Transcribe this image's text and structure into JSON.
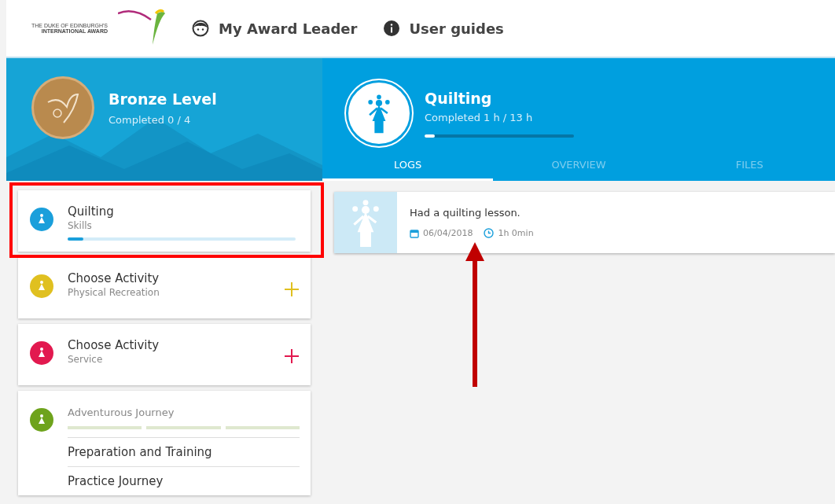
{
  "header": {
    "logo": {
      "line_1": "THE DUKE OF EDINBURGH'S",
      "line_2": "INTERNATIONAL AWARD"
    },
    "nav": [
      {
        "label": "My Award Leader",
        "kind": "face"
      },
      {
        "label": "User guides",
        "kind": "info"
      }
    ]
  },
  "level": {
    "title": "Bronze Level",
    "progress": "Completed 0 / 4"
  },
  "activity": {
    "title": "Quilting",
    "progress": "Completed 1 h / 13 h",
    "level": 0.07
  },
  "tabs": [
    {
      "label": "LOGS",
      "selected": true
    },
    {
      "label": "OVERVIEW",
      "selected": false
    },
    {
      "label": "FILES",
      "selected": false
    }
  ],
  "sections": [
    {
      "kind": "activity",
      "title": "Quilting",
      "subtitle": "Skills",
      "color": "#1a9fdb",
      "level": 0.07
    },
    {
      "kind": "choose",
      "title": "Choose Activity",
      "subtitle": "Physical Recreation",
      "color": "#e0c020"
    },
    {
      "kind": "choose",
      "title": "Choose Activity",
      "subtitle": "Service",
      "color": "#e2194f"
    },
    {
      "kind": "journey",
      "subtitle": "Adventurous Journey",
      "color": "#6ea31c",
      "steps": [
        "Preparation and Training",
        "Practice Journey"
      ]
    }
  ],
  "logs": [
    {
      "text": "Had a quilting lesson.",
      "date": "06/04/2018",
      "duration": "1h 0min"
    }
  ]
}
